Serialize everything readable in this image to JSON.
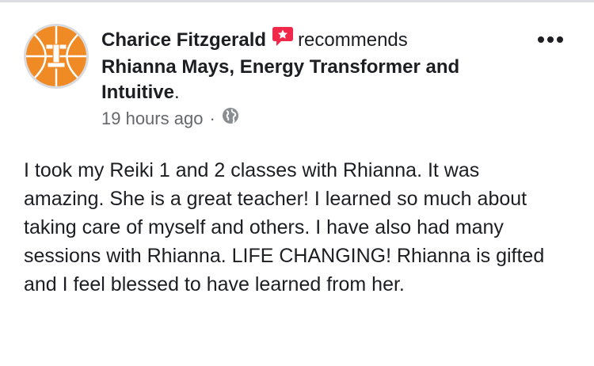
{
  "post": {
    "author": "Charice Fitzgerald",
    "action": "recommends",
    "page_name": "Rhianna Mays, Energy Transformer and Intuitive",
    "period": ".",
    "timestamp": "19 hours ago",
    "separator": "·",
    "privacy_icon": "globe-icon",
    "recommend_icon": "recommendation-star-icon",
    "more_icon": "more-options-icon",
    "body": "I took my Reiki 1 and 2 classes with Rhianna. It was amazing. She is a great teacher! I learned so much about taking care of myself and others. I have also had many sessions with Rhianna. LIFE CHANGING! Rhianna is gifted and I feel blessed to have learned from her."
  },
  "colors": {
    "avatar_orange": "#f08a24",
    "recommend_red": "#f02849",
    "secondary_text": "#65676b",
    "primary_text": "#1c1e21"
  }
}
